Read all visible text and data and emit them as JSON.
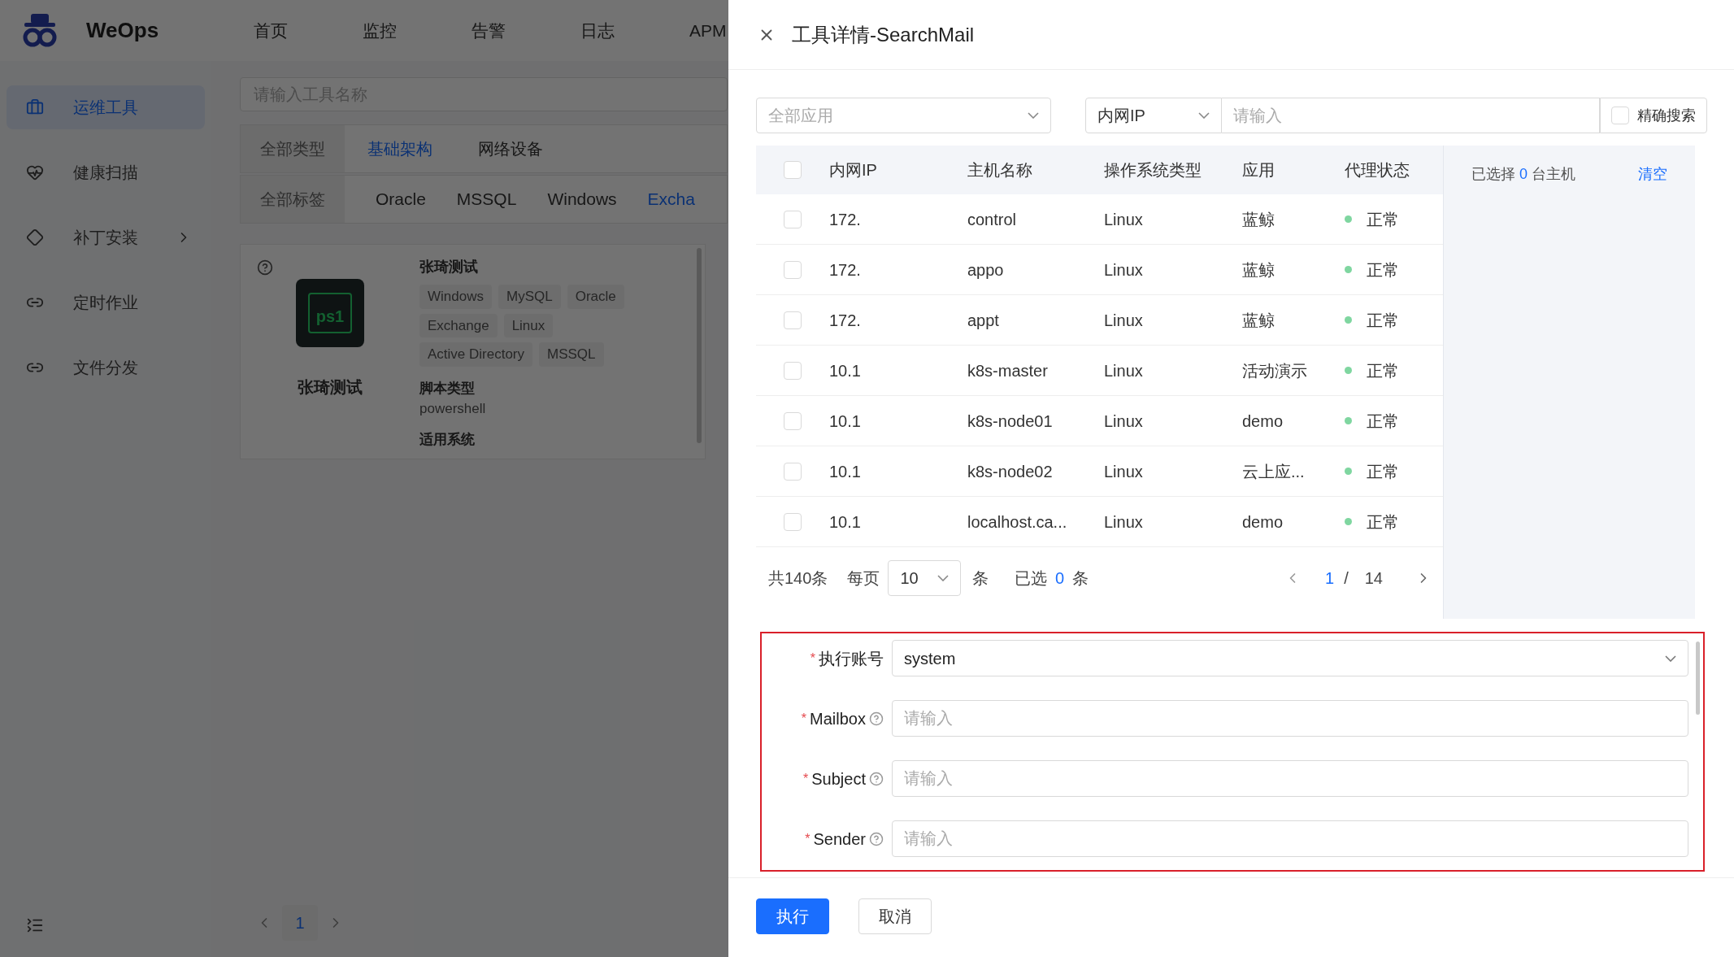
{
  "app": {
    "logo_text": "WeOps",
    "nav": [
      {
        "label": "首页",
        "selected": false
      },
      {
        "label": "监控",
        "selected": false
      },
      {
        "label": "告警",
        "selected": false
      },
      {
        "label": "日志",
        "selected": false
      },
      {
        "label": "APM",
        "selected": false
      }
    ]
  },
  "sidebar": {
    "items": [
      {
        "label": "运维工具",
        "selected": true,
        "has_submenu": false
      },
      {
        "label": "健康扫描",
        "selected": false,
        "has_submenu": false
      },
      {
        "label": "补丁安装",
        "selected": false,
        "has_submenu": true
      },
      {
        "label": "定时作业",
        "selected": false,
        "has_submenu": false
      },
      {
        "label": "文件分发",
        "selected": false,
        "has_submenu": false
      }
    ]
  },
  "search": {
    "placeholder": "请输入工具名称"
  },
  "type_filter": {
    "label": "全部类型",
    "options": [
      {
        "label": "基础架构",
        "selected": true
      },
      {
        "label": "网络设备",
        "selected": false
      }
    ]
  },
  "tag_filter": {
    "label": "全部标签",
    "options": [
      {
        "label": "Oracle",
        "selected": false
      },
      {
        "label": "MSSQL",
        "selected": false
      },
      {
        "label": "Windows",
        "selected": false
      },
      {
        "label": "Excha",
        "selected": true
      }
    ]
  },
  "tool_card": {
    "name": "张琦测试",
    "icon_text": "ps1",
    "title": "张琦测试",
    "tags": [
      "Windows",
      "MySQL",
      "Oracle",
      "Exchange",
      "Linux",
      "Active Directory",
      "MSSQL"
    ],
    "script_type_label": "脚本类型",
    "script_type": "powershell",
    "systems_label": "适用系统"
  },
  "pagination": {
    "pages": [
      {
        "label": "1",
        "selected": true
      }
    ]
  },
  "drawer": {
    "title": "工具详情-SearchMail",
    "app_filter": {
      "placeholder": "全部应用"
    },
    "search_field": {
      "value": "内网IP"
    },
    "search_input": {
      "placeholder": "请输入"
    },
    "exact_search": {
      "label": "精确搜索",
      "checked": false
    },
    "table": {
      "columns": [
        "内网IP",
        "主机名称",
        "操作系统类型",
        "应用",
        "代理状态"
      ],
      "all_checked": false,
      "rows": [
        {
          "checked": false,
          "ip": "172.",
          "hostname": "control",
          "os": "Linux",
          "app": "蓝鲸",
          "status": "正常"
        },
        {
          "checked": false,
          "ip": "172.",
          "hostname": "appo",
          "os": "Linux",
          "app": "蓝鲸",
          "status": "正常"
        },
        {
          "checked": false,
          "ip": "172.",
          "hostname": "appt",
          "os": "Linux",
          "app": "蓝鲸",
          "status": "正常"
        },
        {
          "checked": false,
          "ip": "10.1",
          "hostname": "k8s-master",
          "os": "Linux",
          "app": "活动演示",
          "status": "正常"
        },
        {
          "checked": false,
          "ip": "10.1",
          "hostname": "k8s-node01",
          "os": "Linux",
          "app": "demo",
          "status": "正常"
        },
        {
          "checked": false,
          "ip": "10.1",
          "hostname": "k8s-node02",
          "os": "Linux",
          "app": "云上应...",
          "status": "正常"
        },
        {
          "checked": false,
          "ip": "10.1",
          "hostname": "localhost.ca...",
          "os": "Linux",
          "app": "demo",
          "status": "正常"
        }
      ]
    },
    "selection": {
      "text_before": "已选择",
      "count": "0",
      "text_after": "台主机",
      "clear": "清空"
    },
    "pager": {
      "total": "共140条",
      "per_page_label": "每页",
      "page_size": "10",
      "unit": "条",
      "selected_label": "已选",
      "selected_count": "0",
      "selected_unit": "条",
      "current": "1",
      "separator": "/",
      "pages": "14"
    },
    "form": {
      "required_mark": "*",
      "fields": [
        {
          "kind": "select",
          "label": "执行账号",
          "required": true,
          "help": false,
          "value": "system"
        },
        {
          "kind": "input",
          "label": "Mailbox",
          "required": true,
          "help": true,
          "placeholder": "请输入"
        },
        {
          "kind": "input",
          "label": "Subject",
          "required": true,
          "help": true,
          "placeholder": "请输入"
        },
        {
          "kind": "input",
          "label": "Sender",
          "required": true,
          "help": true,
          "placeholder": "请输入"
        }
      ]
    },
    "buttons": [
      {
        "label": "执行",
        "kind": "primary"
      },
      {
        "label": "取消",
        "kind": "default"
      }
    ]
  }
}
